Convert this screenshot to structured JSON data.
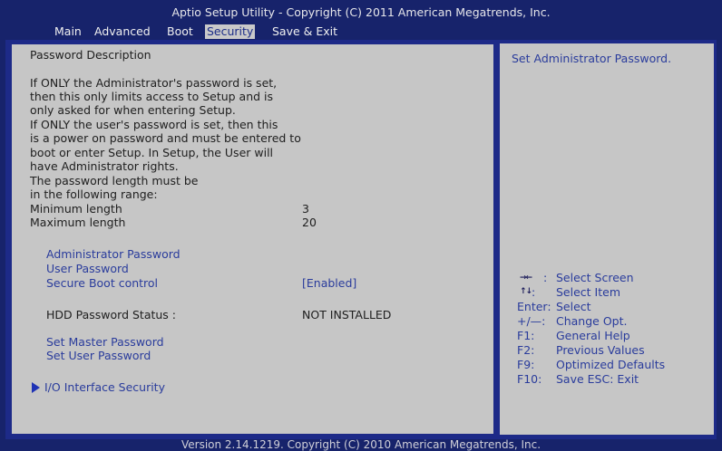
{
  "header": {
    "title": "Aptio Setup Utility - Copyright (C) 2011 American Megatrends, Inc.",
    "tabs": [
      {
        "label": "Main"
      },
      {
        "label": "Advanced"
      },
      {
        "label": "Boot"
      },
      {
        "label": "Security"
      },
      {
        "label": "Save & Exit"
      }
    ],
    "active_tab": "Security"
  },
  "main": {
    "heading": "Password Description",
    "description": [
      "If ONLY the Administrator's password is set,",
      "then this only limits access to Setup and is",
      "only asked for when entering Setup.",
      "If ONLY the user's password is set, then this",
      "is a power on password and must be entered to",
      "boot or enter Setup. In Setup, the User will",
      "have Administrator rights.",
      "The password length must be",
      "in the following range:"
    ],
    "min_label": "Minimum length",
    "min_value": "3",
    "max_label": "Maximum length",
    "max_value": "20",
    "admin_password": "Administrator Password",
    "user_password": "User Password",
    "secure_boot_label": "Secure Boot control",
    "secure_boot_value": "[Enabled]",
    "hdd_status_label": "HDD Password Status :",
    "hdd_status_value": "NOT INSTALLED",
    "set_master": "Set Master Password",
    "set_user": "Set User Password",
    "io_security": "I/O Interface Security"
  },
  "help": {
    "description": "Set Administrator Password.",
    "keys": [
      {
        "key": ":",
        "action": "Select Screen"
      },
      {
        "key": ":",
        "action": "Select Item"
      },
      {
        "key": "Enter:",
        "action": "Select"
      },
      {
        "key": "+/—:",
        "action": "Change Opt."
      },
      {
        "key": "F1:",
        "action": "General Help"
      },
      {
        "key": "F2:",
        "action": "Previous Values"
      },
      {
        "key": "F9:",
        "action": "Optimized Defaults"
      },
      {
        "key": "F10:",
        "action": "Save   ESC: Exit"
      }
    ]
  },
  "footer": {
    "version": "Version 2.14.1219. Copyright (C) 2010 American Megatrends, Inc."
  }
}
